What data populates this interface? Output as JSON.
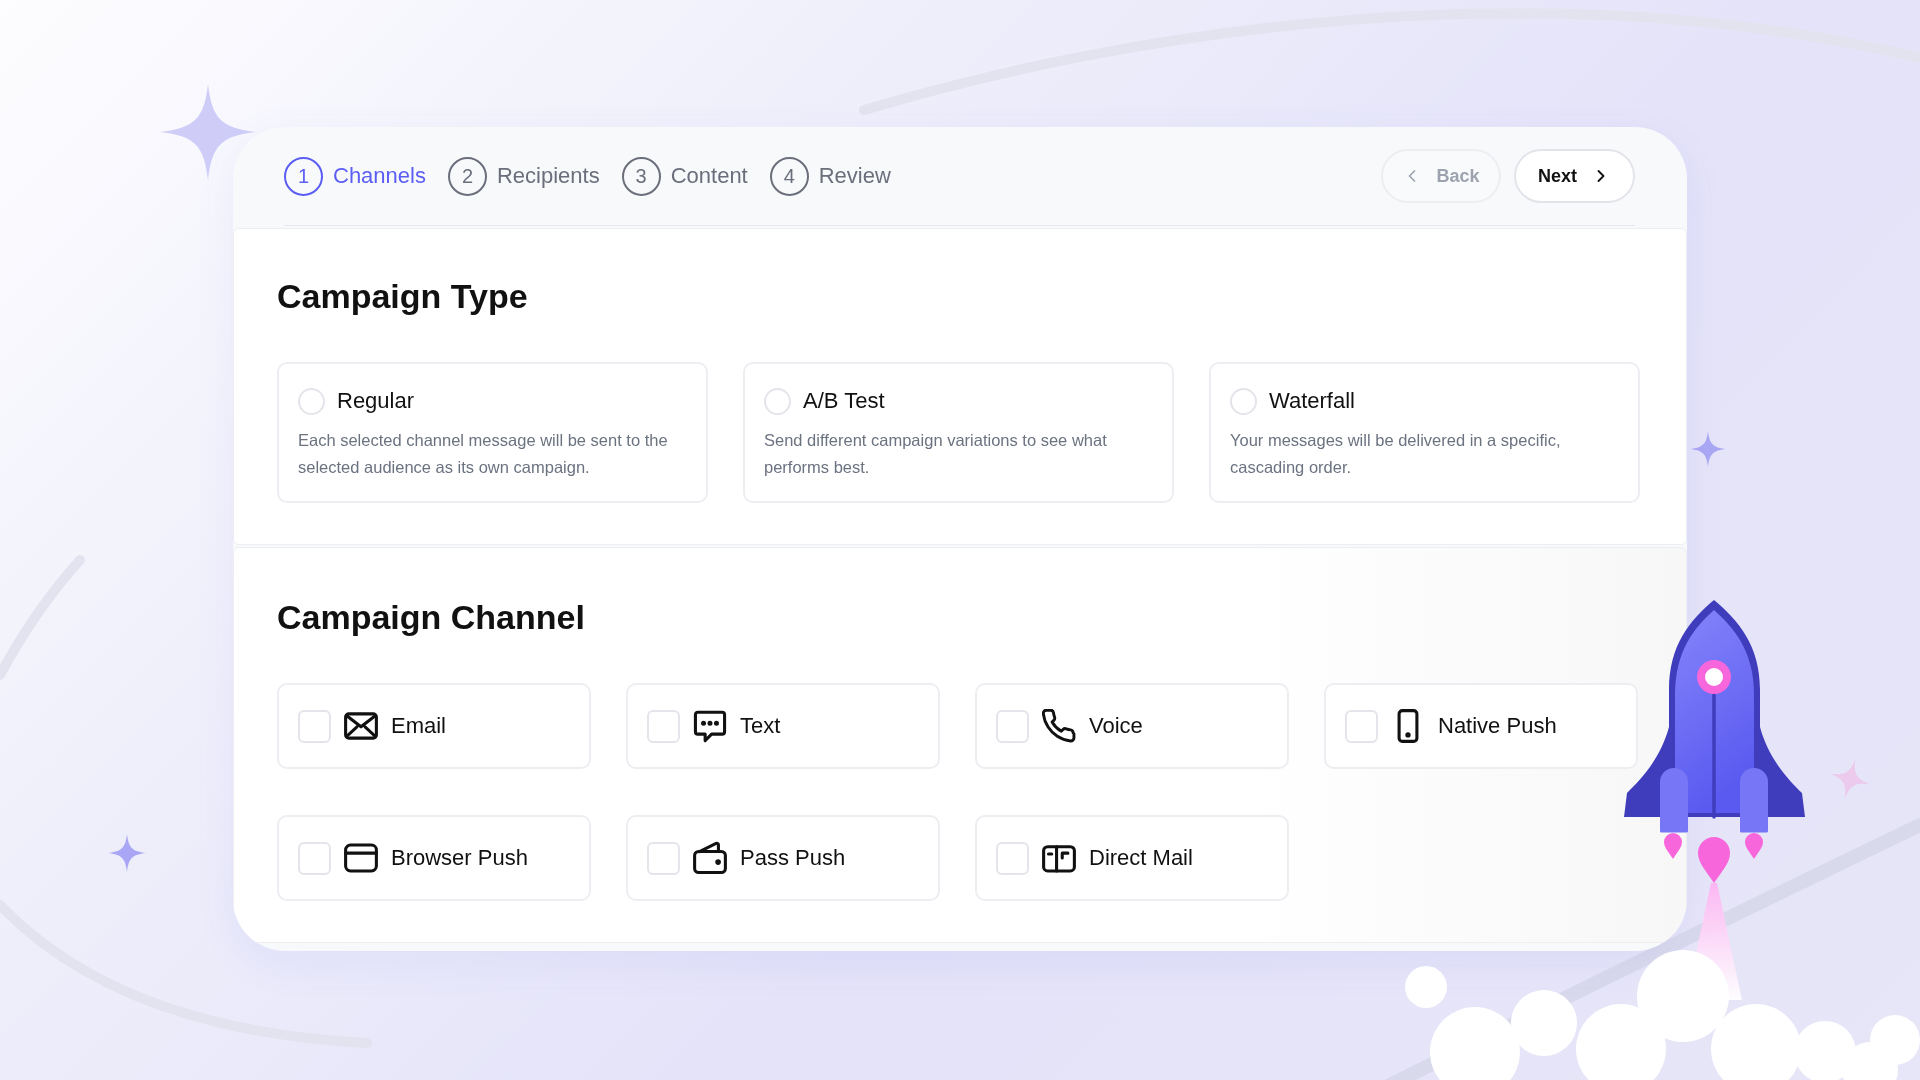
{
  "steps": [
    {
      "number": "1",
      "label": "Channels",
      "selected": true
    },
    {
      "number": "2",
      "label": "Recipients",
      "selected": false
    },
    {
      "number": "3",
      "label": "Content",
      "selected": false
    },
    {
      "number": "4",
      "label": "Review",
      "selected": false
    }
  ],
  "navigation": {
    "back": {
      "label": "Back",
      "disabled": true
    },
    "next": {
      "label": "Next",
      "disabled": false
    }
  },
  "campaign_type": {
    "title": "Campaign Type",
    "options": [
      {
        "label": "Regular",
        "description": "Each selected channel message will be sent to the selected audience as its own campaign.",
        "selected": false
      },
      {
        "label": "A/B Test",
        "description": "Send different campaign variations to see what performs best.",
        "selected": false
      },
      {
        "label": "Waterfall",
        "description": "Your messages will be delivered in a specific, cascading order.",
        "selected": false
      }
    ]
  },
  "campaign_channel": {
    "title": "Campaign Channel",
    "options": [
      {
        "label": "Email",
        "checked": false
      },
      {
        "label": "Text",
        "checked": false
      },
      {
        "label": "Voice",
        "checked": false
      },
      {
        "label": "Native Push",
        "checked": false
      },
      {
        "label": "Browser Push",
        "checked": false
      },
      {
        "label": "Pass Push",
        "checked": false
      },
      {
        "label": "Direct Mail",
        "checked": false
      }
    ]
  }
}
